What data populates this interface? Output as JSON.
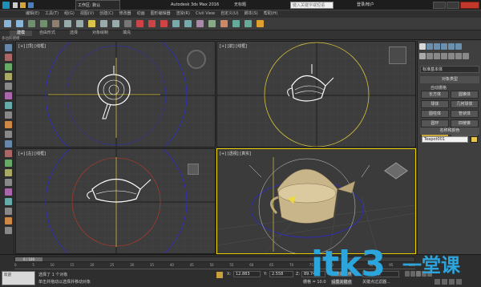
{
  "window": {
    "title": "Autodesk 3ds Max 2016",
    "file_name": "无标题",
    "search_placeholder": "键入关键字或短语",
    "user": "登录/帐户"
  },
  "workspace": {
    "label": "工作区: 默认"
  },
  "menus": [
    "编辑(E)",
    "工具(T)",
    "组(G)",
    "视图(V)",
    "创建(C)",
    "修改器",
    "动画",
    "图形编辑器",
    "渲染(R)",
    "Civil View",
    "自定义(U)",
    "脚本(S)",
    "帮助(H)"
  ],
  "ribbon_tabs": [
    "建模",
    "自由形式",
    "选择",
    "对象绘制",
    "填充"
  ],
  "ribbon_sub": "多边形建模",
  "viewports": [
    {
      "label": "[+] [顶] [线框]"
    },
    {
      "label": "[+] [前] [线框]"
    },
    {
      "label": "[+] [左] [线框]"
    },
    {
      "label": "[+] [透视] [真实]"
    }
  ],
  "command_panel": {
    "dropdown": "标准基本体",
    "rollout_object_type": "对象类型",
    "autogrid": "自动栅格",
    "buttons": [
      "长方体",
      "圆锥体",
      "球体",
      "几何球体",
      "圆柱体",
      "管状体",
      "圆环",
      "四棱锥",
      "茶壶",
      "平面"
    ],
    "rollout_name_color": "名称和颜色",
    "object_name": "Teapot001",
    "object_color": "#e8c84a"
  },
  "timeline": {
    "frame": "0 / 100",
    "ticks": [
      "0",
      "5",
      "10",
      "15",
      "20",
      "25",
      "30",
      "35",
      "40",
      "45",
      "50",
      "55",
      "60",
      "65",
      "70",
      "75",
      "80",
      "85",
      "90",
      "95",
      "100"
    ]
  },
  "status": {
    "selected": "选择了 1 个对象",
    "prompt": "单击并拖动以选择并移动对象",
    "x": "12.883",
    "y": "2.558",
    "z": "89.746",
    "grid": "栅格 = 10.0",
    "autokey": "自动关键点",
    "selected_set": "选定对象",
    "welcome": "欢迎",
    "setkey": "设置关键点",
    "keyfilter": "关键点过滤器..."
  },
  "watermark": {
    "text1": "itk3",
    "text2": "一堂课"
  }
}
